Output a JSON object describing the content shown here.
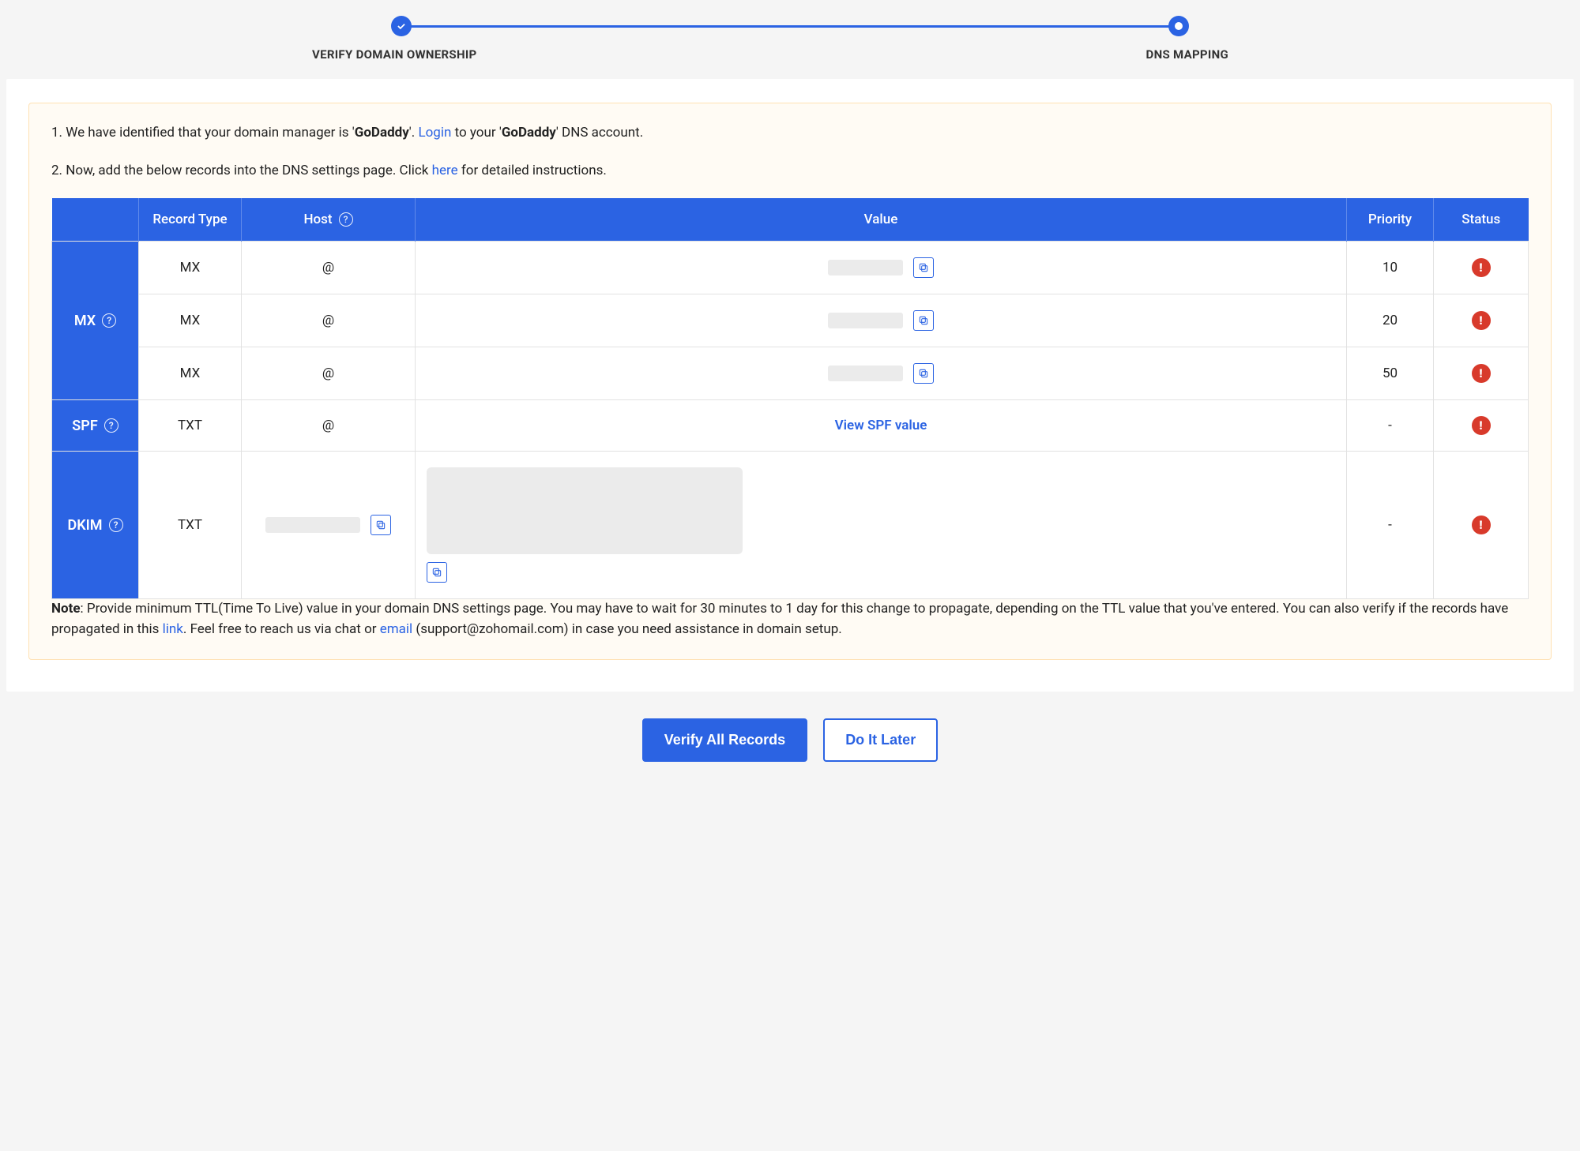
{
  "stepper": {
    "step1": "VERIFY DOMAIN OWNERSHIP",
    "step2": "DNS MAPPING"
  },
  "intro": {
    "line1_pre": "1. We have identified that your domain manager is '",
    "provider": "GoDaddy",
    "line1_mid": "'. ",
    "login_link": "Login",
    "line1_mid2": " to your '",
    "line1_post": "' DNS account.",
    "line2_pre": "2. Now, add the below records into the DNS settings page. Click ",
    "here_link": "here",
    "line2_post": " for detailed instructions."
  },
  "table": {
    "headers": {
      "blank": "",
      "record_type": "Record Type",
      "host": "Host",
      "value": "Value",
      "priority": "Priority",
      "status": "Status"
    },
    "groups": {
      "mx": "MX",
      "spf": "SPF",
      "dkim": "DKIM"
    },
    "rows": {
      "mx1": {
        "type": "MX",
        "host": "@",
        "priority": "10"
      },
      "mx2": {
        "type": "MX",
        "host": "@",
        "priority": "20"
      },
      "mx3": {
        "type": "MX",
        "host": "@",
        "priority": "50"
      },
      "spf": {
        "type": "TXT",
        "host": "@",
        "value_link": "View SPF value",
        "priority": "-"
      },
      "dkim": {
        "type": "TXT",
        "priority": "-"
      }
    }
  },
  "note": {
    "label": "Note",
    "text1": ": Provide minimum TTL(Time To Live) value in your domain DNS settings page. You may have to wait for 30 minutes to 1 day for this change to propagate, depending on the TTL value that you've entered. You can also verify if the records have propagated in this ",
    "link1": "link",
    "text2": ". Feel free to reach us via chat or ",
    "link2": "email",
    "text3": " (support@zohomail.com) in case you need assistance in domain setup."
  },
  "buttons": {
    "verify": "Verify All Records",
    "later": "Do It Later"
  }
}
